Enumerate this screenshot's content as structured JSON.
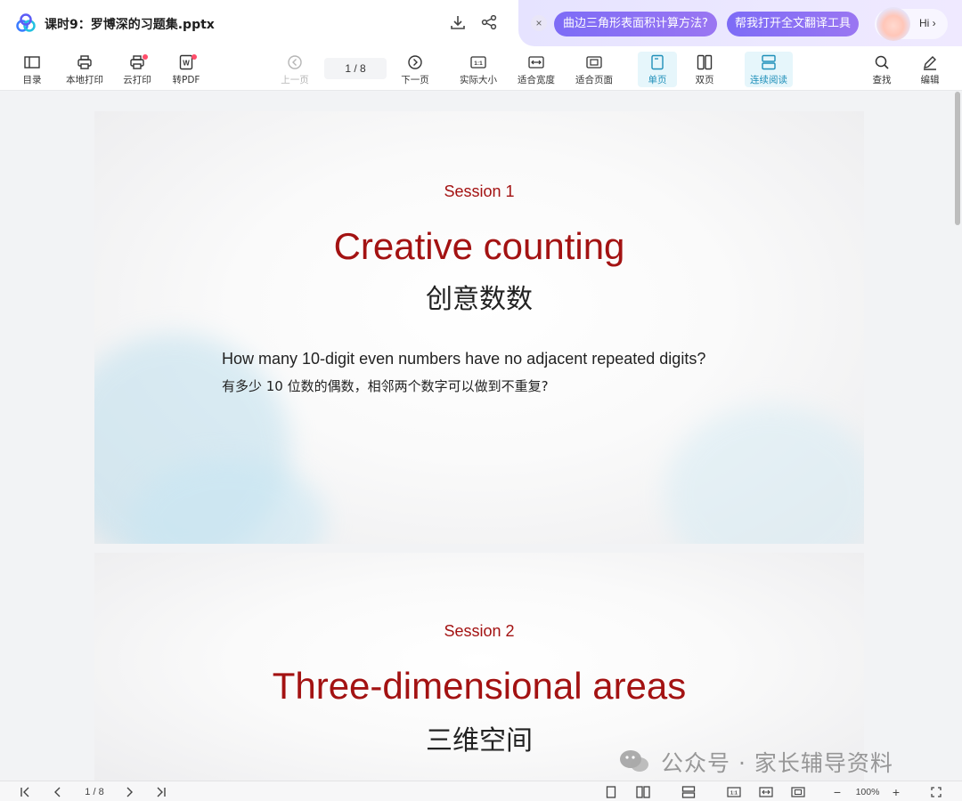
{
  "titlebar": {
    "doc_title": "课时9：罗博深的习题集.pptx",
    "ai_close": "×",
    "ai_suggestions": [
      "曲边三角形表面积计算方法?",
      "帮我打开全文翻译工具"
    ],
    "hi_label": "Hi ›"
  },
  "toolbar": {
    "toc": "目录",
    "local_print": "本地打印",
    "cloud_print": "云打印",
    "to_pdf": "转PDF",
    "prev_page": "上一页",
    "page_indicator": "1  / 8",
    "next_page": "下一页",
    "actual_size": "实际大小",
    "fit_width": "适合宽度",
    "fit_page": "适合页面",
    "single_page": "单页",
    "double_page": "双页",
    "continuous": "连续阅读",
    "search": "查找",
    "edit": "编辑"
  },
  "slides": [
    {
      "session": "Session 1",
      "title": "Creative counting",
      "subtitle": "创意数数",
      "question_en": "How many 10-digit even numbers have no adjacent repeated digits?",
      "question_zh": "有多少 10 位数的偶数，相邻两个数字可以做到不重复?"
    },
    {
      "session": "Session 2",
      "title": "Three-dimensional areas",
      "subtitle": "三维空间"
    }
  ],
  "statusbar": {
    "page_indicator": "1  / 8",
    "zoom": "100%",
    "zoom_out": "−",
    "zoom_in": "+"
  },
  "watermark": "公众号 · 家长辅导资料",
  "colors": {
    "slide_accent": "#a31212",
    "active_tool": "#1e8fb9",
    "ai_pill": "#8870f4",
    "notification_dot": "#ff4d6a"
  }
}
